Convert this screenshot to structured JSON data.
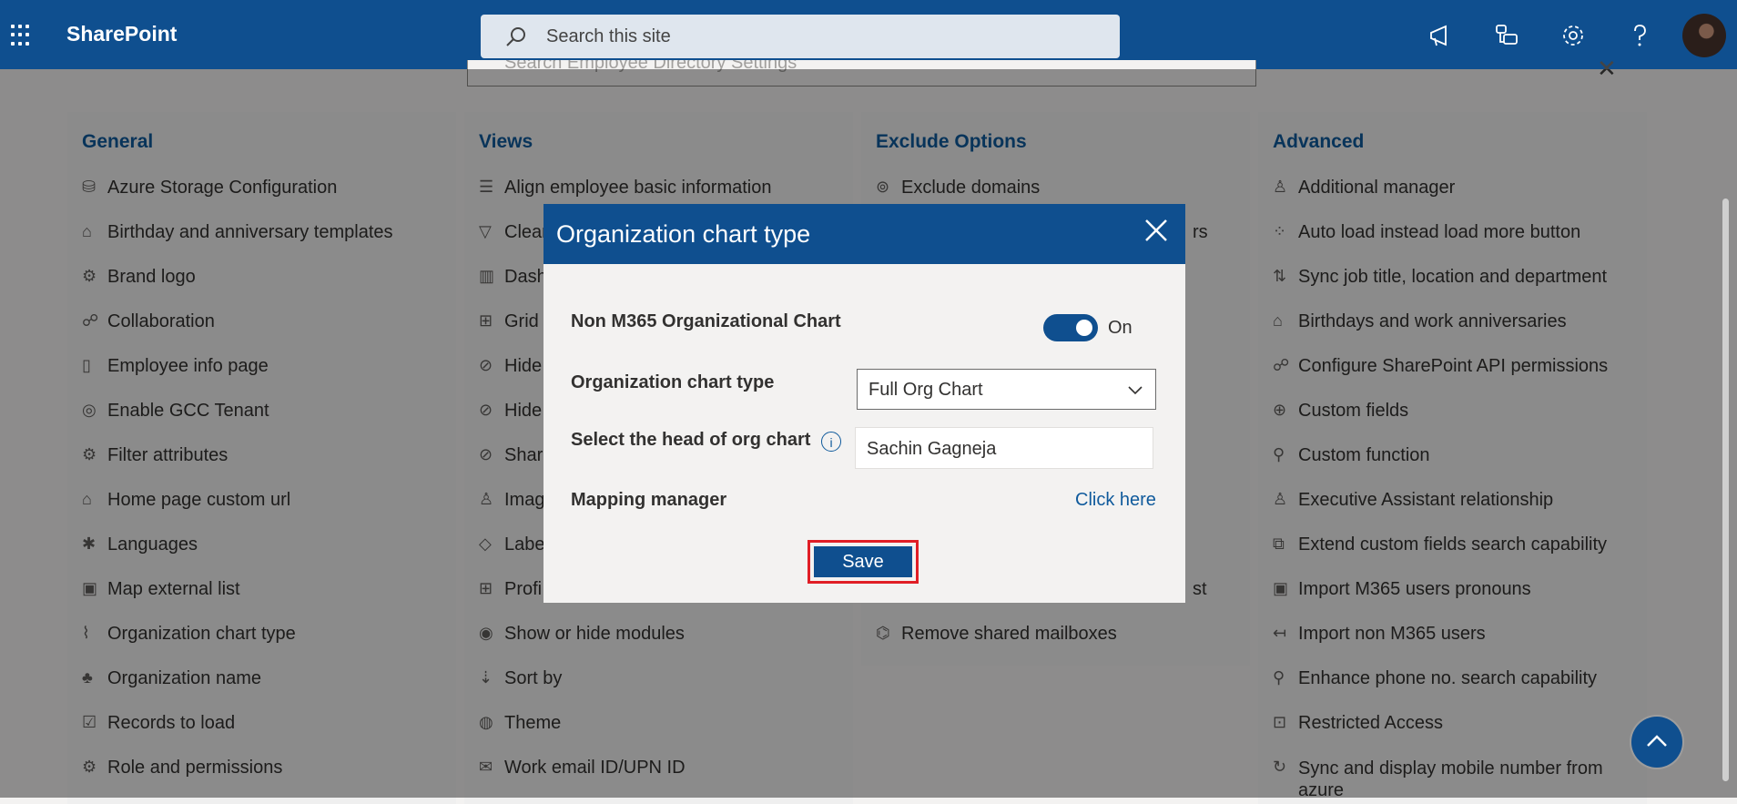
{
  "app": {
    "name": "SharePoint"
  },
  "topbar": {
    "search_placeholder": "Search this site",
    "icons": [
      "megaphone-icon",
      "app-icon",
      "gear-icon",
      "help-icon"
    ]
  },
  "settings_search": {
    "placeholder": "Search Employee Directory Settings"
  },
  "columns": {
    "general": {
      "title": "General",
      "items": [
        "Azure Storage Configuration",
        "Birthday and anniversary templates",
        "Brand logo",
        "Collaboration",
        "Employee info page",
        "Enable GCC Tenant",
        "Filter attributes",
        "Home page custom url",
        "Languages",
        "Map external list",
        "Organization chart type",
        "Organization name",
        "Records to load",
        "Role and permissions"
      ]
    },
    "views": {
      "title": "Views",
      "items": [
        "Align employee basic information",
        "Clear",
        "Dash",
        "Grid",
        "Hide",
        "Hide",
        "Shar",
        "Imag",
        "Labe",
        "Profi",
        "Show or hide modules",
        "Sort by",
        "Theme",
        "Work email ID/UPN ID"
      ]
    },
    "exclude": {
      "title": "Exclude Options",
      "items": [
        "Exclude domains",
        "rs",
        "",
        "",
        "",
        "",
        "",
        "",
        "",
        "st",
        "Remove shared mailboxes"
      ]
    },
    "advanced": {
      "title": "Advanced",
      "items": [
        "Additional manager",
        "Auto load instead load more button",
        "Sync job title, location and department",
        "Birthdays and work anniversaries",
        "Configure SharePoint API permissions",
        "Custom fields",
        "Custom function",
        "Executive Assistant relationship",
        "Extend custom fields search capability",
        "Import M365 users pronouns",
        "Import non M365 users",
        "Enhance phone no. search capability",
        "Restricted Access",
        "Sync and display mobile number from azure"
      ]
    }
  },
  "modal": {
    "title": "Organization chart type",
    "non_m365_label": "Non M365 Organizational Chart",
    "toggle_state": "On",
    "chart_type_label": "Organization chart type",
    "chart_type_value": "Full Org Chart",
    "head_label": "Select the head of org chart",
    "head_value": "Sachin Gagneja",
    "mapping_label": "Mapping manager",
    "mapping_link": "Click here",
    "save_label": "Save"
  },
  "colors": {
    "brand": "#0f4f8f",
    "accent": "#0f5a9c",
    "highlight": "#e01e26"
  }
}
